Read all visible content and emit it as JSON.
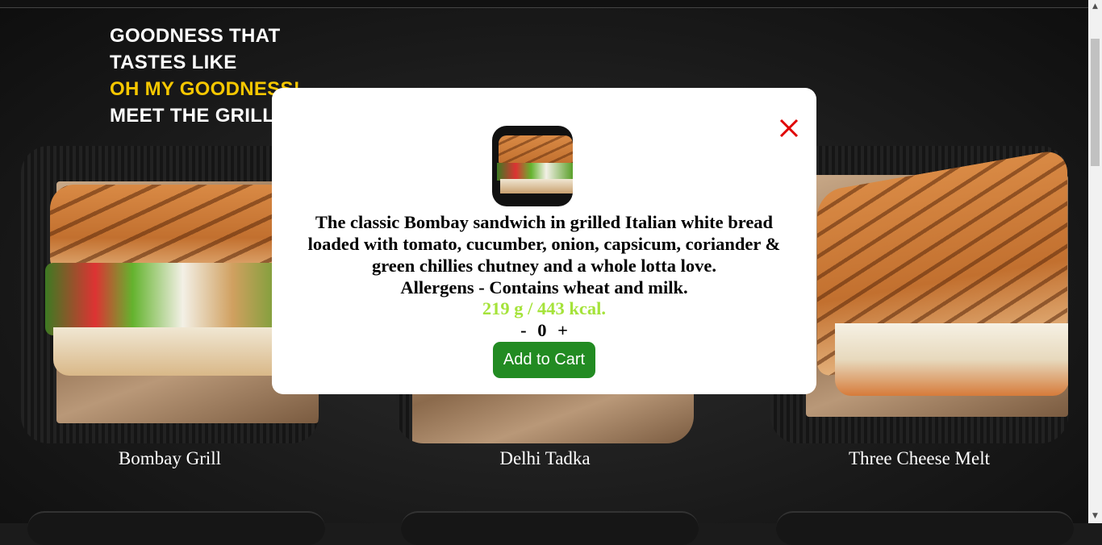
{
  "hero": {
    "line1": "GOODNESS THAT",
    "line2": "TASTES LIKE",
    "line3": "OH MY GOODNESS!",
    "line4": "MEET THE GRILL"
  },
  "menu": {
    "items": [
      {
        "name": "Bombay Grill"
      },
      {
        "name": "Delhi Tadka"
      },
      {
        "name": "Three Cheese Melt"
      }
    ]
  },
  "modal": {
    "description_line1": "The classic Bombay sandwich in grilled Italian white bread",
    "description_line2": "loaded with tomato, cucumber, onion, capsicum, coriander &",
    "description_line3": "green chillies chutney and a whole lotta love.",
    "allergens": "Allergens - Contains wheat and milk.",
    "nutrition": "219 g / 443 kcal.",
    "decrement": "-",
    "quantity": "0",
    "increment": "+",
    "add_button": "Add to Cart",
    "close_icon": "close-icon"
  },
  "colors": {
    "accent_yellow": "#f6c700",
    "nutrition_green": "#a5e33a",
    "button_green": "#228b22",
    "close_red": "#e00000"
  }
}
